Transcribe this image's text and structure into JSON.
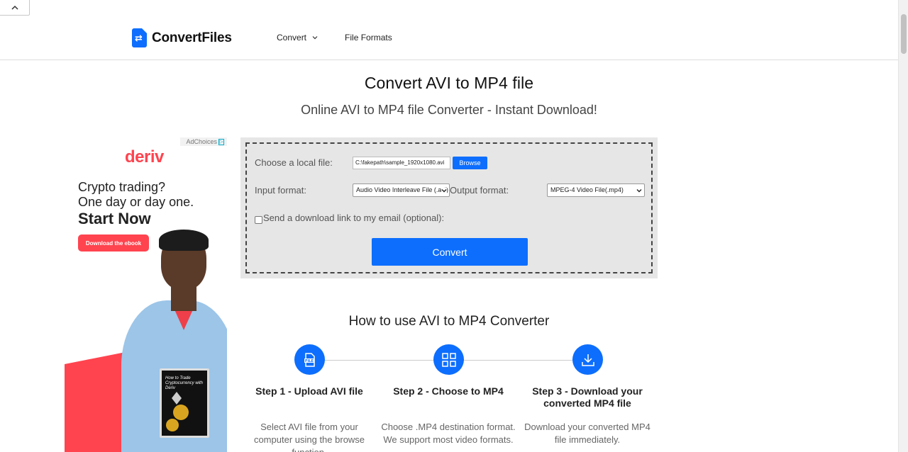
{
  "brand": {
    "name": "ConvertFiles"
  },
  "nav": {
    "convert": "Convert",
    "file_formats": "File Formats"
  },
  "page": {
    "title": "Convert AVI to MP4 file",
    "subtitle": "Online AVI to MP4 file Converter - Instant Download!"
  },
  "ad": {
    "ad_choices": "AdChoices",
    "brand": "deriv",
    "line1": "Crypto trading?",
    "line2": "One day or day one.",
    "line3": "Start Now",
    "cta": "Download the ebook",
    "book_title": "How to Trade Cryptocurrency with Deriv"
  },
  "converter": {
    "file_label": "Choose a local file:",
    "file_value": "C:\\fakepath\\sample_1920x1080.avi",
    "browse_label": "Browse",
    "input_label": "Input format:",
    "input_value": "Audio Video Interleave File (.avi)",
    "output_label": "Output format:",
    "output_value": "MPEG-4 Video File(.mp4)",
    "email_label": "Send a download link to my email (optional):",
    "email_checked": false,
    "convert_label": "Convert"
  },
  "howto": {
    "title": "How to use AVI to MP4 Converter",
    "steps": [
      {
        "icon": "file-icon",
        "title": "Step 1 - Upload AVI file",
        "text": "Select AVI file from your computer using the browse function."
      },
      {
        "icon": "grid-icon",
        "title": "Step 2 - Choose to MP4",
        "text": "Choose .MP4 destination format. We support most video formats."
      },
      {
        "icon": "download-icon",
        "title": "Step 3 - Download your converted MP4 file",
        "text": "Download your converted MP4 file immediately."
      }
    ]
  },
  "colors": {
    "accent": "#0d6efd",
    "ad_red": "#ff444f"
  }
}
